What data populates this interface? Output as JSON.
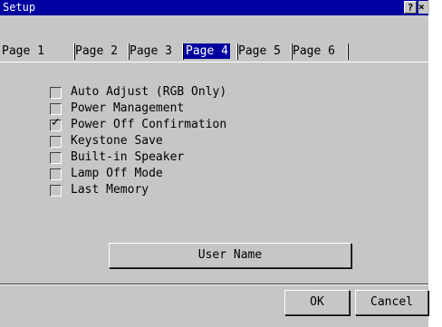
{
  "window": {
    "title": "Setup",
    "help_label": "?",
    "close_label": "×"
  },
  "tabs": [
    {
      "label": "Page 1",
      "active": false
    },
    {
      "label": "Page 2",
      "active": false
    },
    {
      "label": "Page 3",
      "active": false
    },
    {
      "label": "Page 4",
      "active": true
    },
    {
      "label": "Page 5",
      "active": false
    },
    {
      "label": "Page 6",
      "active": false
    }
  ],
  "options": [
    {
      "label": "Auto Adjust (RGB Only)",
      "checked": false
    },
    {
      "label": "Power Management",
      "checked": false
    },
    {
      "label": "Power Off Confirmation",
      "checked": true
    },
    {
      "label": "Keystone Save",
      "checked": false
    },
    {
      "label": "Built-in Speaker",
      "checked": false
    },
    {
      "label": "Lamp Off Mode",
      "checked": false
    },
    {
      "label": "Last Memory",
      "checked": false
    }
  ],
  "buttons": {
    "user_name": "User Name",
    "ok": "OK",
    "cancel": "Cancel"
  },
  "colors": {
    "title_bar": "#0000a0",
    "active_tab": "#0000a0",
    "face": "#c6c6c6"
  },
  "check_mark": "✓"
}
